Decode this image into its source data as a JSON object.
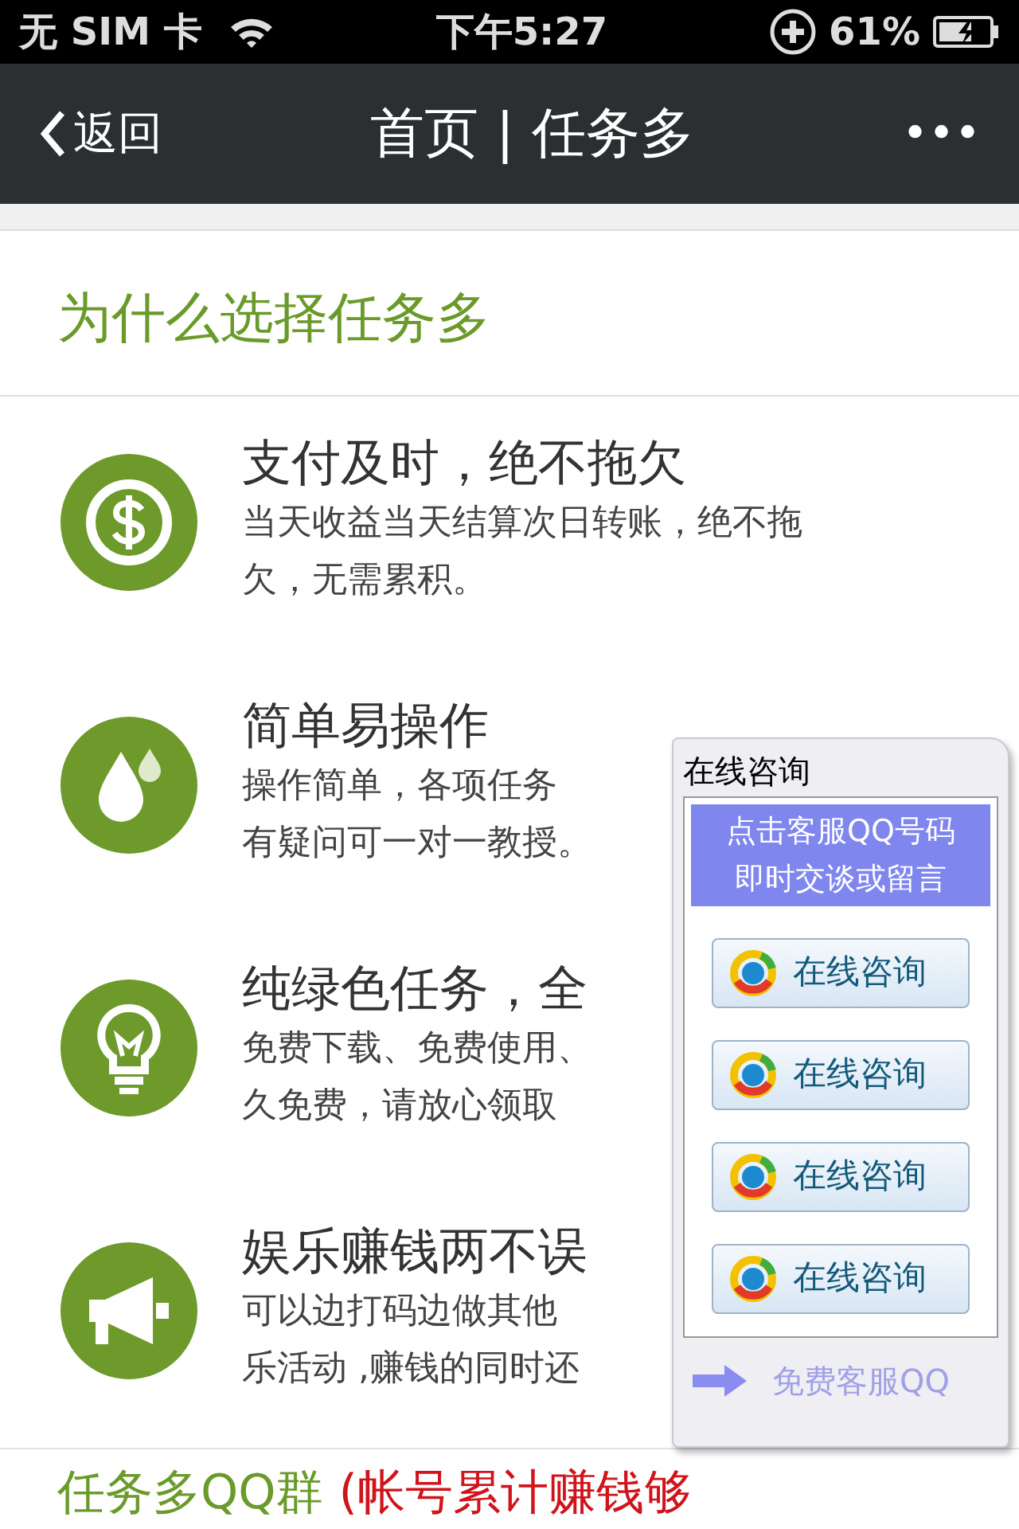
{
  "status_bar": {
    "carrier": "无 SIM 卡",
    "time": "下午5:27",
    "battery": "61%"
  },
  "nav_bar": {
    "back": "返回",
    "title": "首页 | 任务多",
    "more": "•••"
  },
  "section": {
    "heading": "为什么选择任务多",
    "features": [
      {
        "kind": "dollar",
        "title": "支付及时，绝不拖欠",
        "lines": [
          "当天收益当天结算次日转账，绝不拖",
          "欠，无需累积。"
        ]
      },
      {
        "kind": "drop",
        "title": "简单易操作",
        "lines": [
          "操作简单，各项任务",
          "有疑问可一对一教授。"
        ]
      },
      {
        "kind": "bulb",
        "title": "纯绿色任务，全",
        "lines": [
          "免费下载、免费使用、",
          "久免费，请放心领取"
        ]
      },
      {
        "kind": "megaphone",
        "title": "娱乐赚钱两不误",
        "lines": [
          "可以边打码边做其他",
          "乐活动 ,赚钱的同时还"
        ]
      }
    ]
  },
  "footer_heading": {
    "green": "任务多QQ群",
    "red": "(帐号累计赚钱够"
  },
  "consult_panel": {
    "title": "在线咨询",
    "notice": [
      "点击客服QQ号码",
      "即时交谈或留言"
    ],
    "buttons": [
      "在线咨询",
      "在线咨询",
      "在线咨询",
      "在线咨询"
    ],
    "footer": "免费客服QQ"
  }
}
